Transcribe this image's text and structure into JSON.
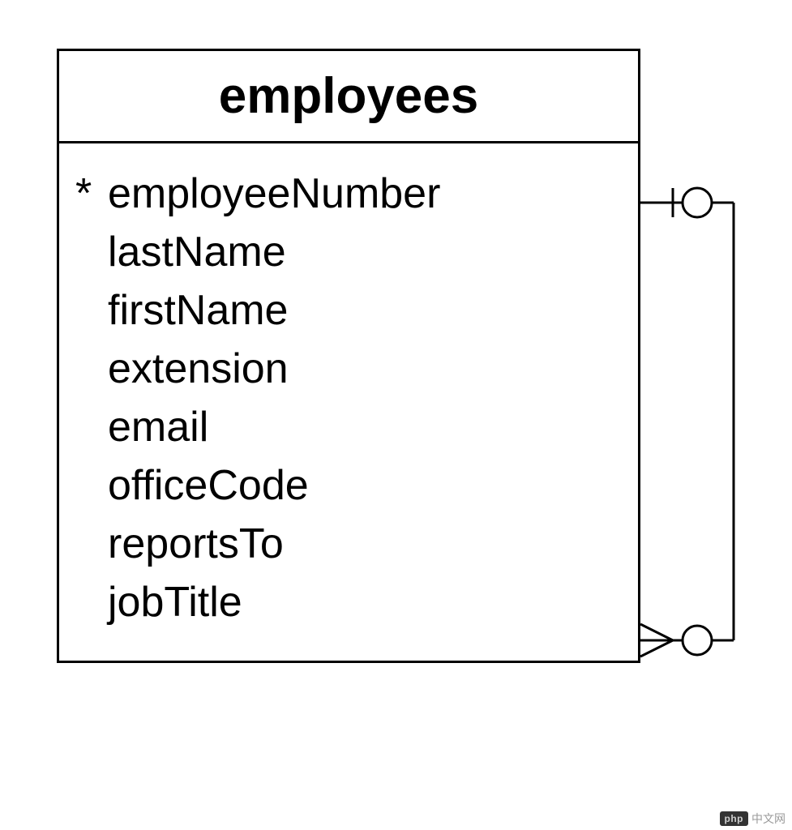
{
  "entity": {
    "name": "employees",
    "attributes": [
      {
        "name": "employeeNumber",
        "pk": true
      },
      {
        "name": "lastName",
        "pk": false
      },
      {
        "name": "firstName",
        "pk": false
      },
      {
        "name": "extension",
        "pk": false
      },
      {
        "name": "email",
        "pk": false
      },
      {
        "name": "officeCode",
        "pk": false
      },
      {
        "name": "reportsTo",
        "pk": false
      },
      {
        "name": "jobTitle",
        "pk": false
      }
    ]
  },
  "relationship": {
    "type": "self-reference",
    "from_end": "zero-or-one",
    "to_end": "zero-or-many"
  },
  "watermark": {
    "badge": "php",
    "text": "中文网"
  }
}
